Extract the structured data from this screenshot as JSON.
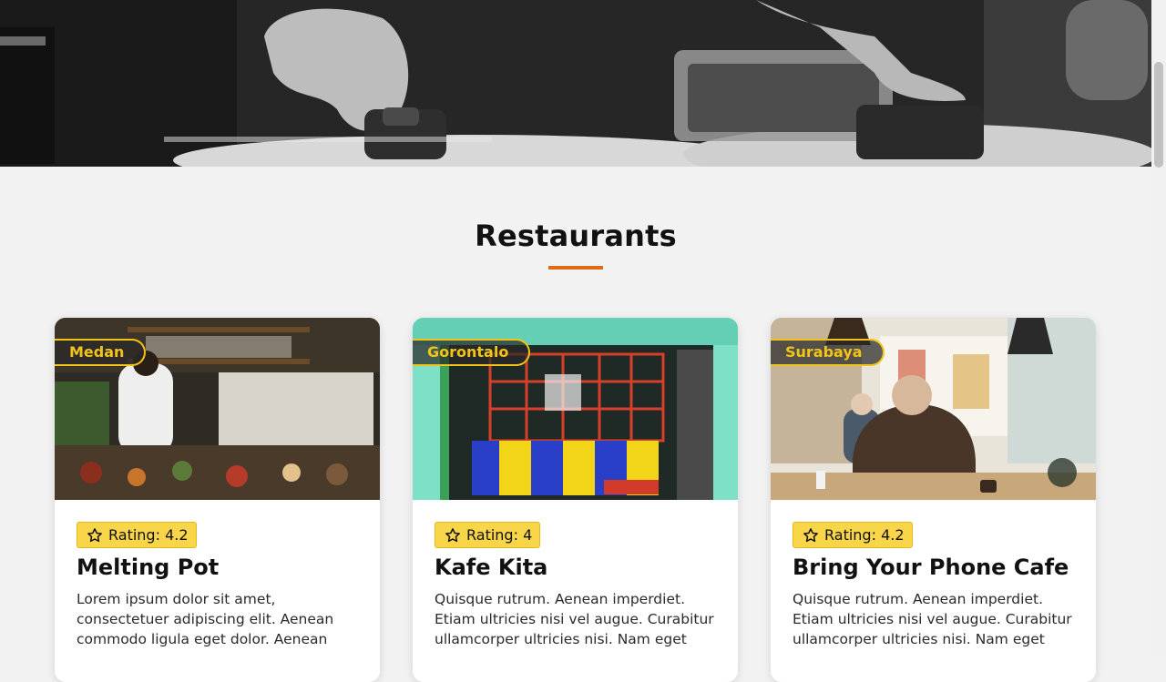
{
  "page": {
    "section_title": "Restaurants",
    "accent_color": "#e06b12",
    "badge_color": "#f2c417",
    "rating_color": "#f9d649"
  },
  "restaurants": [
    {
      "city": "Medan",
      "rating": "Rating: 4.2",
      "name": "Melting Pot",
      "description": "Lorem ipsum dolor sit amet, consectetuer adipiscing elit. Aenean commodo ligula eget dolor. Aenean massa. Cum sociis..."
    },
    {
      "city": "Gorontalo",
      "rating": "Rating: 4",
      "name": "Kafe Kita",
      "description": "Quisque rutrum. Aenean imperdiet. Etiam ultricies nisi vel augue. Curabitur ullamcorper ultricies nisi. Nam eget dui...."
    },
    {
      "city": "Surabaya",
      "rating": "Rating: 4.2",
      "name": "Bring Your Phone Cafe",
      "description": "Quisque rutrum. Aenean imperdiet. Etiam ultricies nisi vel augue. Curabitur ullamcorper ultricies nisi. Nam eget dui...."
    }
  ],
  "icons": {
    "rating": "star-icon"
  }
}
